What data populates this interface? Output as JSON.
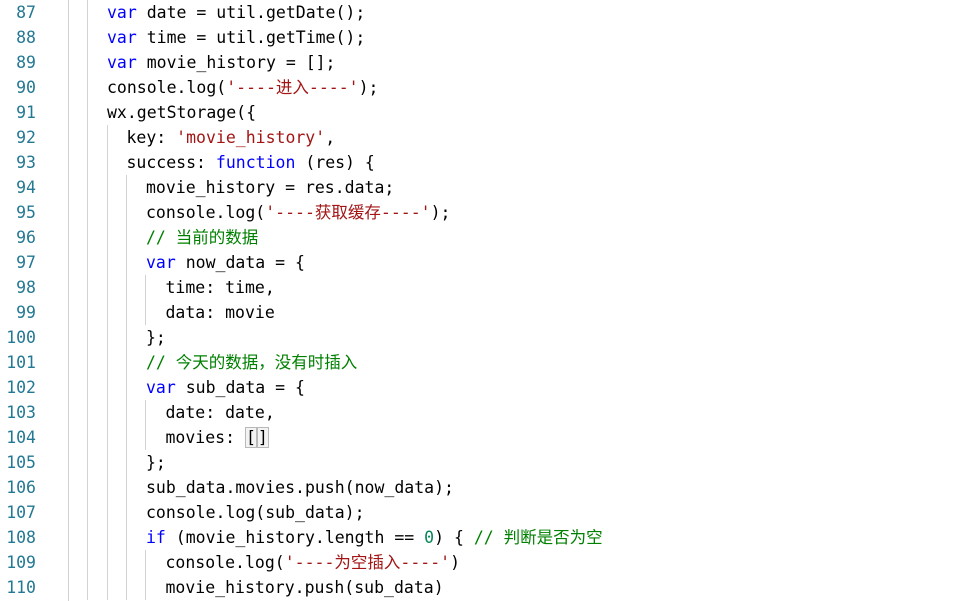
{
  "editor": {
    "lines": [
      {
        "n": "87",
        "indent": 0,
        "tokens": [
          [
            "kw",
            "var"
          ],
          [
            "",
            " date = util.getDate();"
          ]
        ]
      },
      {
        "n": "88",
        "indent": 0,
        "tokens": [
          [
            "kw",
            "var"
          ],
          [
            "",
            " time = util.getTime();"
          ]
        ]
      },
      {
        "n": "89",
        "indent": 0,
        "tokens": [
          [
            "kw",
            "var"
          ],
          [
            "",
            " movie_history = [];"
          ]
        ]
      },
      {
        "n": "90",
        "indent": 0,
        "tokens": [
          [
            "",
            "console.log("
          ],
          [
            "str",
            "'----进入----'"
          ],
          [
            "",
            ");"
          ]
        ]
      },
      {
        "n": "91",
        "indent": 0,
        "tokens": [
          [
            "",
            "wx.getStorage({"
          ]
        ]
      },
      {
        "n": "92",
        "indent": 1,
        "tokens": [
          [
            "",
            "key: "
          ],
          [
            "str",
            "'movie_history'"
          ],
          [
            "",
            ","
          ]
        ]
      },
      {
        "n": "93",
        "indent": 1,
        "tokens": [
          [
            "",
            "success: "
          ],
          [
            "kw",
            "function"
          ],
          [
            "",
            " (res) {"
          ]
        ]
      },
      {
        "n": "94",
        "indent": 2,
        "tokens": [
          [
            "",
            "movie_history = res.data;"
          ]
        ]
      },
      {
        "n": "95",
        "indent": 2,
        "tokens": [
          [
            "",
            "console.log("
          ],
          [
            "str",
            "'----获取缓存----'"
          ],
          [
            "",
            ");"
          ]
        ]
      },
      {
        "n": "96",
        "indent": 2,
        "tokens": [
          [
            "cmt",
            "// 当前的数据"
          ]
        ]
      },
      {
        "n": "97",
        "indent": 2,
        "tokens": [
          [
            "kw",
            "var"
          ],
          [
            "",
            " now_data = {"
          ]
        ]
      },
      {
        "n": "98",
        "indent": 3,
        "tokens": [
          [
            "",
            "time: time,"
          ]
        ]
      },
      {
        "n": "99",
        "indent": 3,
        "tokens": [
          [
            "",
            "data: movie"
          ]
        ]
      },
      {
        "n": "100",
        "indent": 2,
        "tokens": [
          [
            "",
            "};"
          ]
        ]
      },
      {
        "n": "101",
        "indent": 2,
        "tokens": [
          [
            "cmt",
            "// 今天的数据，没有时插入"
          ]
        ]
      },
      {
        "n": "102",
        "indent": 2,
        "tokens": [
          [
            "kw",
            "var"
          ],
          [
            "",
            " sub_data = {"
          ]
        ]
      },
      {
        "n": "103",
        "indent": 3,
        "tokens": [
          [
            "",
            "date: date,"
          ]
        ]
      },
      {
        "n": "104",
        "indent": 3,
        "tokens": [
          [
            "",
            "movies: "
          ],
          [
            "bracket-match",
            "["
          ],
          [
            "bracket-match",
            "]"
          ]
        ]
      },
      {
        "n": "105",
        "indent": 2,
        "tokens": [
          [
            "",
            "};"
          ]
        ]
      },
      {
        "n": "106",
        "indent": 2,
        "tokens": [
          [
            "",
            "sub_data.movies.push(now_data);"
          ]
        ]
      },
      {
        "n": "107",
        "indent": 2,
        "tokens": [
          [
            "",
            "console.log(sub_data);"
          ]
        ]
      },
      {
        "n": "108",
        "indent": 2,
        "tokens": [
          [
            "kw",
            "if"
          ],
          [
            "",
            " (movie_history.length == "
          ],
          [
            "num",
            "0"
          ],
          [
            "",
            ") { "
          ],
          [
            "cmt",
            "// 判断是否为空"
          ]
        ]
      },
      {
        "n": "109",
        "indent": 3,
        "tokens": [
          [
            "",
            "console.log("
          ],
          [
            "str",
            "'----为空插入----'"
          ],
          [
            "",
            ")"
          ]
        ]
      },
      {
        "n": "110",
        "indent": 3,
        "tokens": [
          [
            "",
            "movie_history.push(sub_data)"
          ]
        ]
      }
    ]
  }
}
